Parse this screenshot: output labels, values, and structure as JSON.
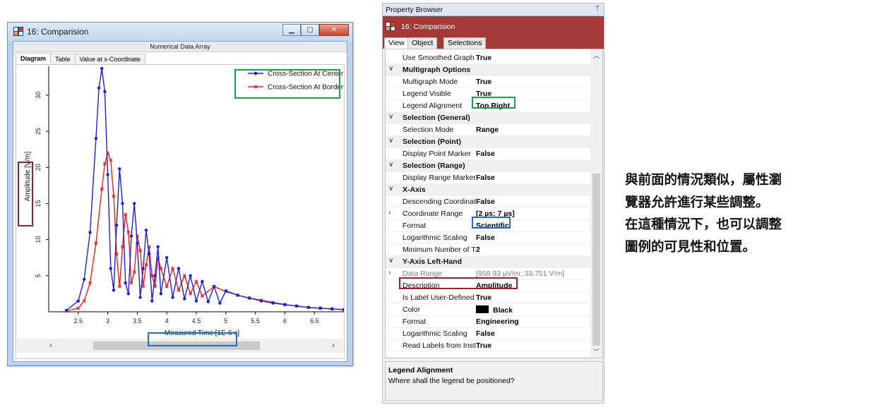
{
  "window": {
    "title": "16: Comparision",
    "header": "Numerical Data Array",
    "tabs": [
      "Diagram",
      "Table",
      "Value at x-Coordinate"
    ],
    "scroll_left": "‹",
    "scroll_right": "›"
  },
  "chart_data": {
    "type": "line",
    "ylabel": "Amplitude [V/m]",
    "xlabel": "Measured Time [1E-6 s]",
    "xlim": [
      2.0,
      7.0
    ],
    "ylim": [
      0,
      34
    ],
    "x_ticks": [
      "2.5",
      "3",
      "3.5",
      "4",
      "4.5",
      "5",
      "5.5",
      "6",
      "6.5"
    ],
    "y_ticks": [
      "5",
      "10",
      "15",
      "20",
      "25",
      "30"
    ],
    "legend_position": "top-right",
    "series": [
      {
        "name": "Cross-Section At Center",
        "color": "#1f1fd6",
        "x": [
          2.3,
          2.5,
          2.6,
          2.7,
          2.8,
          2.85,
          2.9,
          2.95,
          3.0,
          3.05,
          3.1,
          3.15,
          3.2,
          3.25,
          3.3,
          3.35,
          3.4,
          3.45,
          3.5,
          3.55,
          3.6,
          3.65,
          3.7,
          3.75,
          3.8,
          3.85,
          3.9,
          4.0,
          4.1,
          4.2,
          4.3,
          4.4,
          4.5,
          4.6,
          4.7,
          4.8,
          4.9,
          5.0,
          5.2,
          5.4,
          5.6,
          5.8,
          6.0,
          6.2,
          6.4,
          6.6,
          6.8,
          7.0
        ],
        "y": [
          0.2,
          1.5,
          4.5,
          11.0,
          24.0,
          31.0,
          33.7,
          30.5,
          19.0,
          6.0,
          3.0,
          12.0,
          19.8,
          15.0,
          4.0,
          2.5,
          10.5,
          15.0,
          9.5,
          2.0,
          6.0,
          11.3,
          8.0,
          1.5,
          5.0,
          9.0,
          2.5,
          7.5,
          2.0,
          6.0,
          1.8,
          5.0,
          1.5,
          4.2,
          1.4,
          3.5,
          1.2,
          2.9,
          2.3,
          1.9,
          1.5,
          1.2,
          1.0,
          0.8,
          0.6,
          0.5,
          0.4,
          0.3
        ]
      },
      {
        "name": "Cross-Section At Border",
        "color": "#ee1e1e",
        "x": [
          2.3,
          2.5,
          2.6,
          2.7,
          2.8,
          2.9,
          2.95,
          3.0,
          3.05,
          3.1,
          3.15,
          3.2,
          3.25,
          3.3,
          3.35,
          3.4,
          3.45,
          3.5,
          3.55,
          3.6,
          3.65,
          3.7,
          3.75,
          3.8,
          3.85,
          3.9,
          4.0,
          4.1,
          4.2,
          4.3,
          4.4,
          4.5,
          4.6,
          4.8,
          5.0,
          5.2,
          5.4,
          5.6,
          5.8,
          6.0,
          6.2,
          6.4,
          6.6,
          6.8,
          7.0
        ],
        "y": [
          0.1,
          0.5,
          1.5,
          4.0,
          9.5,
          17.0,
          20.5,
          22.0,
          21.0,
          16.0,
          8.0,
          3.5,
          9.0,
          13.5,
          11.0,
          4.0,
          5.5,
          10.5,
          8.5,
          3.5,
          6.5,
          9.0,
          5.0,
          3.5,
          7.5,
          6.0,
          3.5,
          6.0,
          3.0,
          5.0,
          2.5,
          4.2,
          2.2,
          3.5,
          2.8,
          2.3,
          1.9,
          1.6,
          1.3,
          1.0,
          0.8,
          0.6,
          0.5,
          0.4,
          0.3
        ]
      }
    ]
  },
  "property_browser": {
    "title": "Property Browser",
    "pin": "ᛘ",
    "object": "16: Comparision",
    "tabs": [
      "View",
      "Object",
      "Selections"
    ],
    "rows": [
      {
        "type": "prop",
        "name": "Use Smoothed Graph",
        "value": "True"
      },
      {
        "type": "cat",
        "name": "Multigraph Options"
      },
      {
        "type": "prop",
        "name": "Multigraph Mode",
        "value": "True"
      },
      {
        "type": "prop",
        "name": "Legend Visible",
        "value": "True"
      },
      {
        "type": "prop",
        "name": "Legend Alignment",
        "value": "Top Right"
      },
      {
        "type": "cat",
        "name": "Selection (General)"
      },
      {
        "type": "prop",
        "name": "Selection Mode",
        "value": "Range"
      },
      {
        "type": "cat",
        "name": "Selection (Point)"
      },
      {
        "type": "prop",
        "name": "Display Point Marker",
        "value": "False"
      },
      {
        "type": "cat",
        "name": "Selection (Range)"
      },
      {
        "type": "prop",
        "name": "Display Range Marker",
        "value": "False"
      },
      {
        "type": "cat",
        "name": "X-Axis"
      },
      {
        "type": "prop",
        "name": "Descending Coordinates",
        "value": "False"
      },
      {
        "type": "sub",
        "name": "Coordinate Range",
        "value": "[2 µs; 7 µs]"
      },
      {
        "type": "prop",
        "name": "Format",
        "value": "Scientific"
      },
      {
        "type": "prop",
        "name": "Logarithmic Scaling",
        "value": "False"
      },
      {
        "type": "prop",
        "name": "Minimum Number of Ticks",
        "value": "2"
      },
      {
        "type": "cat",
        "name": "Y-Axis Left-Hand"
      },
      {
        "type": "subdim",
        "name": "Data Range",
        "value": "[958.93 µV/m; 33.751 V/m]"
      },
      {
        "type": "prop",
        "name": "Description",
        "value": "Amplitude"
      },
      {
        "type": "prop",
        "name": "Is Label User-Defined",
        "value": "True"
      },
      {
        "type": "color",
        "name": "Color",
        "value": "Black"
      },
      {
        "type": "prop",
        "name": "Format",
        "value": "Engineering"
      },
      {
        "type": "prop",
        "name": "Logarithmic Scaling",
        "value": "False"
      },
      {
        "type": "prop",
        "name": "Read Labels from Instrument",
        "value": "True"
      }
    ],
    "desc_title": "Legend Alignment",
    "desc_text": "Where shall the legend be positioned?"
  },
  "note": {
    "lines": [
      "與前面的情況類似，屬性瀏",
      "覽器允許進行某些調整。",
      "在這種情況下，也可以調整",
      "圖例的可見性和位置。"
    ]
  },
  "colors": {
    "highlight_green": "#1aa14a",
    "highlight_blue": "#1f6fc0",
    "highlight_red": "#a51e2d",
    "object_bar": "#a43a37"
  }
}
